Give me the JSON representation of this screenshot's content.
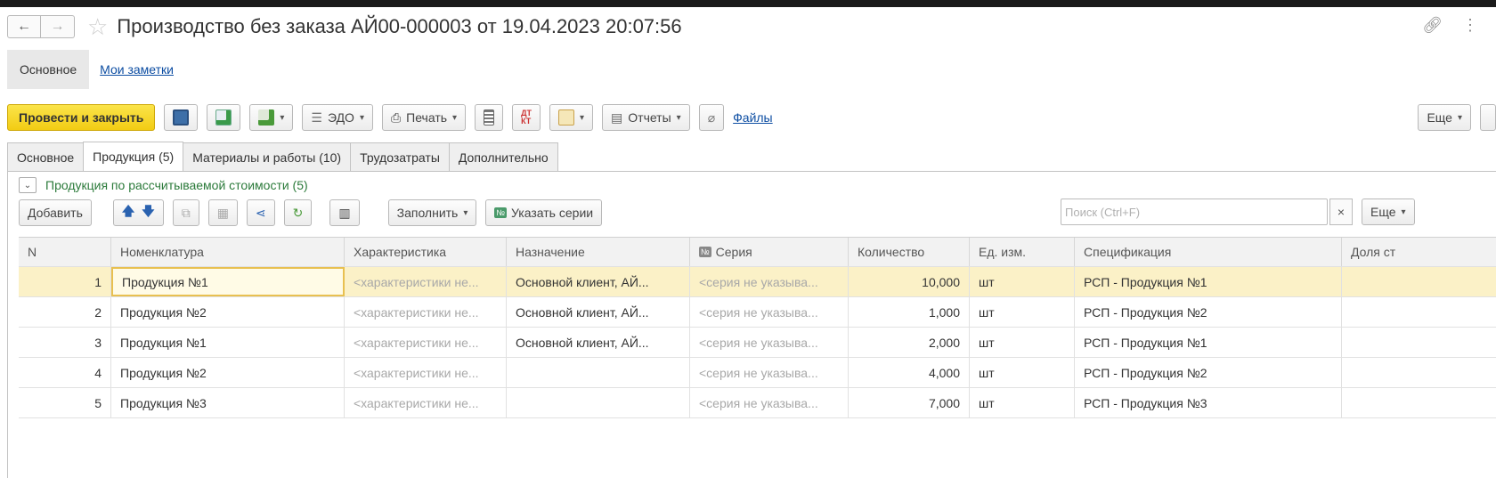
{
  "window": {
    "title": "Производство без заказа АЙ00-000003 от 19.04.2023 20:07:56"
  },
  "subtabs": {
    "main": "Основное",
    "notes": "Мои заметки"
  },
  "toolbar": {
    "post_close": "Провести и закрыть",
    "edo": "ЭДО",
    "print": "Печать",
    "reports": "Отчеты",
    "files": "Файлы",
    "more": "Еще"
  },
  "tabs": [
    "Основное",
    "Продукция (5)",
    "Материалы и работы (10)",
    "Трудозатраты",
    "Дополнительно"
  ],
  "group": {
    "title": "Продукция по рассчитываемой стоимости (5)"
  },
  "table_toolbar": {
    "add": "Добавить",
    "fill": "Заполнить",
    "series": "Указать серии",
    "search_placeholder": "Поиск (Ctrl+F)",
    "clear": "×",
    "more": "Еще"
  },
  "columns": {
    "n": "N",
    "nom": "Номенклатура",
    "char": "Характеристика",
    "naz": "Назначение",
    "ser": "Серия",
    "qty": "Количество",
    "unit": "Ед. изм.",
    "spec": "Спецификация",
    "dol": "Доля ст"
  },
  "series_badge": "№",
  "rows": [
    {
      "n": "1",
      "nom": "Продукция №1",
      "char": "<характеристики не...",
      "naz": "Основной клиент, АЙ...",
      "ser": "<серия не указыва...",
      "qty": "10,000",
      "unit": "шт",
      "spec": "РСП - Продукция №1"
    },
    {
      "n": "2",
      "nom": "Продукция №2",
      "char": "<характеристики не...",
      "naz": "Основной клиент, АЙ...",
      "ser": "<серия не указыва...",
      "qty": "1,000",
      "unit": "шт",
      "spec": "РСП - Продукция №2"
    },
    {
      "n": "3",
      "nom": "Продукция №1",
      "char": "<характеристики не...",
      "naz": "Основной клиент, АЙ...",
      "ser": "<серия не указыва...",
      "qty": "2,000",
      "unit": "шт",
      "spec": "РСП - Продукция №1"
    },
    {
      "n": "4",
      "nom": "Продукция №2",
      "char": "<характеристики не...",
      "naz": "",
      "ser": "<серия не указыва...",
      "qty": "4,000",
      "unit": "шт",
      "spec": "РСП - Продукция №2"
    },
    {
      "n": "5",
      "nom": "Продукция №3",
      "char": "<характеристики не...",
      "naz": "",
      "ser": "<серия не указыва...",
      "qty": "7,000",
      "unit": "шт",
      "spec": "РСП - Продукция №3"
    }
  ],
  "icons": {
    "back": "arrow-left-icon",
    "forward": "arrow-right-icon",
    "favorite": "star-icon",
    "link": "link-icon",
    "menu": "vertical-dots-icon",
    "save": "floppy-disk-icon",
    "post": "post-document-icon",
    "create_based": "create-based-on-icon",
    "edo": "edo-icon",
    "print": "printer-icon",
    "journal": "journal-icon",
    "dt_kt": "dt-kt-icon",
    "structure": "document-structure-icon",
    "reports": "reports-icon",
    "attach": "paperclip-icon",
    "up": "arrow-up-icon",
    "down": "arrow-down-icon",
    "copy": "copy-icon",
    "paste": "paste-icon",
    "share": "share-icon",
    "recalc": "recalculate-icon",
    "barcode": "barcode-icon",
    "collapse": "collapse-chevron-icon"
  },
  "colors": {
    "primary_button": "#f2cc13",
    "selected_row": "#fbf1c7",
    "link": "#0c4da2",
    "group_title": "#2b7a3a"
  }
}
